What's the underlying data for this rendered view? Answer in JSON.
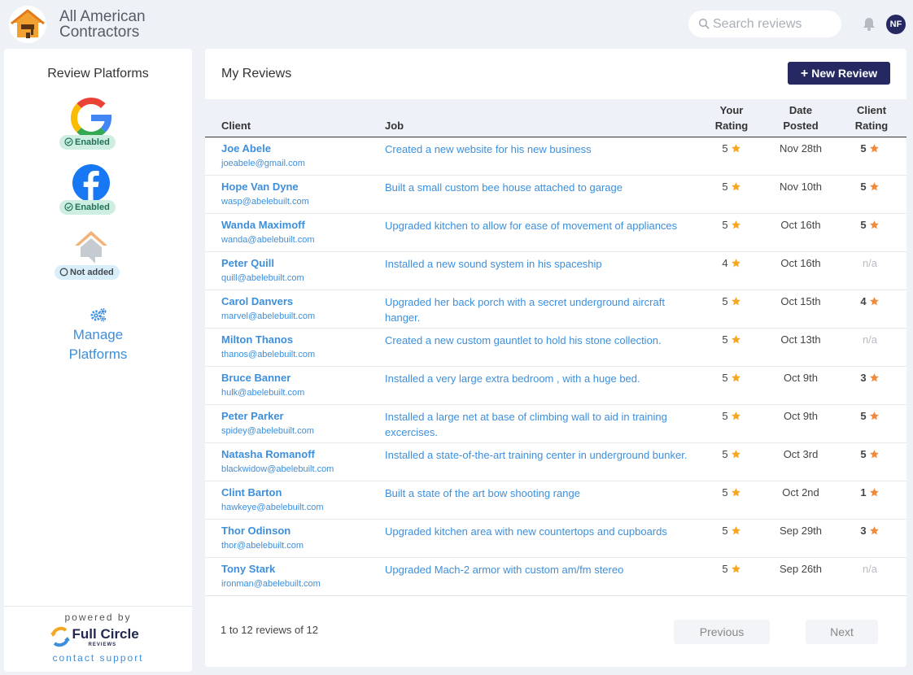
{
  "app": {
    "brand_line1": "All American",
    "brand_line2": "Contractors"
  },
  "header": {
    "search_placeholder": "Search reviews",
    "avatar_initials": "NF"
  },
  "sidebar": {
    "title": "Review Platforms",
    "platforms": [
      {
        "name": "Google",
        "icon": "google-icon",
        "status": "Enabled"
      },
      {
        "name": "Facebook",
        "icon": "facebook-icon",
        "status": "Enabled"
      },
      {
        "name": "HomeAdvisor",
        "icon": "home-icon",
        "status": "Not added"
      }
    ],
    "manage_line1": "Manage",
    "manage_line2": "Platforms",
    "powered_by": "powered by",
    "powered_logo": "Full Circle",
    "powered_logo_sub": "REVIEWS",
    "contact_support": "contact support"
  },
  "main": {
    "title": "My Reviews",
    "new_review_label": "New Review",
    "columns": {
      "client": "Client",
      "job": "Job",
      "your_rating_1": "Your",
      "your_rating_2": "Rating",
      "date_posted_1": "Date",
      "date_posted_2": "Posted",
      "client_rating_1": "Client",
      "client_rating_2": "Rating"
    },
    "reviews": [
      {
        "name": "Joe Abele",
        "email": "joeabele@gmail.com",
        "job": "Created a new website for his new business",
        "your_rating": "5",
        "date": "Nov 28th",
        "client_rating": "5"
      },
      {
        "name": "Hope Van Dyne",
        "email": "wasp@abelebuilt.com",
        "job": "Built a small custom bee house attached to garage",
        "your_rating": "5",
        "date": "Nov 10th",
        "client_rating": "5"
      },
      {
        "name": "Wanda Maximoff",
        "email": "wanda@abelebuilt.com",
        "job": "Upgraded kitchen to allow for ease of movement of appliances",
        "your_rating": "5",
        "date": "Oct 16th",
        "client_rating": "5"
      },
      {
        "name": "Peter Quill",
        "email": "quill@abelebuilt.com",
        "job": "Installed a new sound system in his spaceship",
        "your_rating": "4",
        "date": "Oct 16th",
        "client_rating": "n/a"
      },
      {
        "name": "Carol Danvers",
        "email": "marvel@abelebuilt.com",
        "job": "Upgraded her back porch with a secret underground aircraft hanger.",
        "your_rating": "5",
        "date": "Oct 15th",
        "client_rating": "4"
      },
      {
        "name": "Milton Thanos",
        "email": "thanos@abelebuilt.com",
        "job": "Created a new custom gauntlet to hold his stone collection.",
        "your_rating": "5",
        "date": "Oct 13th",
        "client_rating": "n/a"
      },
      {
        "name": "Bruce Banner",
        "email": "hulk@abelebuilt.com",
        "job": "Installed a very large extra bedroom , with a huge bed.",
        "your_rating": "5",
        "date": "Oct 9th",
        "client_rating": "3"
      },
      {
        "name": "Peter Parker",
        "email": "spidey@abelebuilt.com",
        "job": "Installed a large net at base of climbing wall to aid in training excercises.",
        "your_rating": "5",
        "date": "Oct 9th",
        "client_rating": "5"
      },
      {
        "name": "Natasha Romanoff",
        "email": "blackwidow@abelebuilt.com",
        "job": "Installed a state-of-the-art training center in underground bunker.",
        "your_rating": "5",
        "date": "Oct 3rd",
        "client_rating": "5"
      },
      {
        "name": "Clint Barton",
        "email": "hawkeye@abelebuilt.com",
        "job": "Built a state of the art bow shooting range",
        "your_rating": "5",
        "date": "Oct 2nd",
        "client_rating": "1"
      },
      {
        "name": "Thor Odinson",
        "email": "thor@abelebuilt.com",
        "job": "Upgraded kitchen area with new countertops and cupboards",
        "your_rating": "5",
        "date": "Sep 29th",
        "client_rating": "3"
      },
      {
        "name": "Tony Stark",
        "email": "ironman@abelebuilt.com",
        "job": "Upgraded Mach-2 armor with custom am/fm stereo",
        "your_rating": "5",
        "date": "Sep 26th",
        "client_rating": "n/a"
      }
    ],
    "pagination": {
      "summary": "1 to 12 reviews of 12",
      "previous": "Previous",
      "next": "Next"
    }
  },
  "colors": {
    "accent": "#3d8fdc",
    "primary_button": "#252861",
    "star": "#f5a623",
    "star_client": "#f08a3c",
    "enabled_badge": "#cdeee0",
    "not_added_badge": "#d8eefa"
  }
}
